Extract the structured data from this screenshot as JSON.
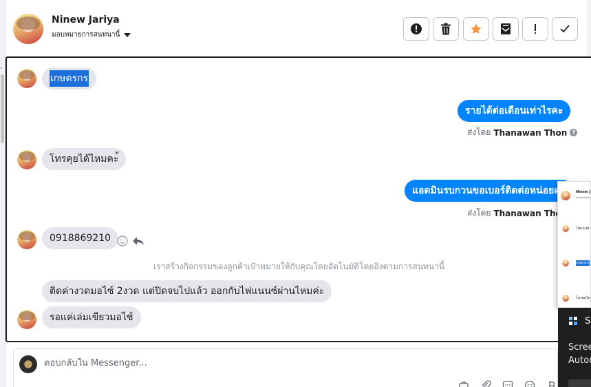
{
  "header": {
    "contact_name": "Ninew Jariya",
    "assign_label": "มอบหมายการสนทนานี้",
    "tools": [
      {
        "name": "spam-button",
        "icon": "alert-circle-icon"
      },
      {
        "name": "delete-button",
        "icon": "trash-icon"
      },
      {
        "name": "star-button",
        "icon": "star-icon",
        "color": "#f7923b"
      },
      {
        "name": "mark-unread-button",
        "icon": "envelope-icon"
      },
      {
        "name": "follow-up-button",
        "icon": "exclamation-icon"
      },
      {
        "name": "done-button",
        "icon": "check-icon"
      }
    ]
  },
  "messages": {
    "m1": {
      "text": "เกษตรกร"
    },
    "m2": {
      "text": "รายได้ต่อเดือนเท่าไรคะ",
      "sent_by_label": "ส่งโดย",
      "sender": "Thanawan Thon"
    },
    "m3": {
      "text": "โทรคุยได้ไหมคะ้"
    },
    "m4": {
      "text": "แอดมินรบกวนขอเบอร์ติดต่อหน่อยคะ",
      "sent_by_label": "ส่งโดย",
      "sender": "Thanawan Thon"
    },
    "m5": {
      "text": "0918869210"
    },
    "system_note": "เราสร้างกิจกรรมของลูกค้าเป้าหมายให้กับคุณโดยอัตโนมัติโดยอิงตามการสนทนานี้",
    "m6": {
      "text": "ติดค่างวดมอไซ์  2งวด  แต่ปิดจบไปแล้ว   ออกกับไฟแนนซ์ผ่านไหมค่ะ"
    },
    "m7": {
      "text": "รอแค่เล่มเขียวมอไซ์"
    }
  },
  "preview": {
    "name": "Ninew J",
    "line1": "ไฟแนนซ์",
    "line2": "เกษตรกร",
    "line3": "โทรคุยได"
  },
  "toast": {
    "title": "Sn",
    "body_line1": "Scree",
    "body_line2": "Autor"
  },
  "composer": {
    "placeholder": "ตอบกลับใน Messenger..."
  },
  "colors": {
    "accent": "#0084ff",
    "incoming_bubble": "#e4e6eb",
    "selection": "#1e6fd9",
    "star": "#f7923b"
  }
}
